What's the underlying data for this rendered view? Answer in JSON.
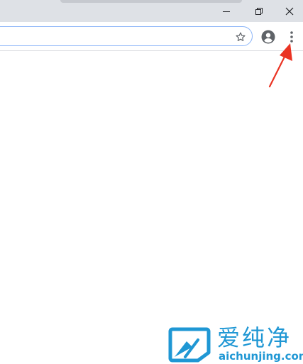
{
  "browser": {
    "window_controls": {
      "minimize_icon": "minimize-icon",
      "restore_icon": "restore-icon",
      "close_icon": "close-icon"
    },
    "toolbar": {
      "address_value": "",
      "bookmark_icon": "star-icon",
      "profile_icon": "account-circle-icon",
      "menu_icon": "three-dots-vertical-icon"
    }
  },
  "annotation": {
    "arrow_color": "#ea3323",
    "points_to": "menu-button"
  },
  "watermark": {
    "brand_text": "爱纯净",
    "url_text": "aichunjing.com",
    "color": "#1f97d4"
  }
}
